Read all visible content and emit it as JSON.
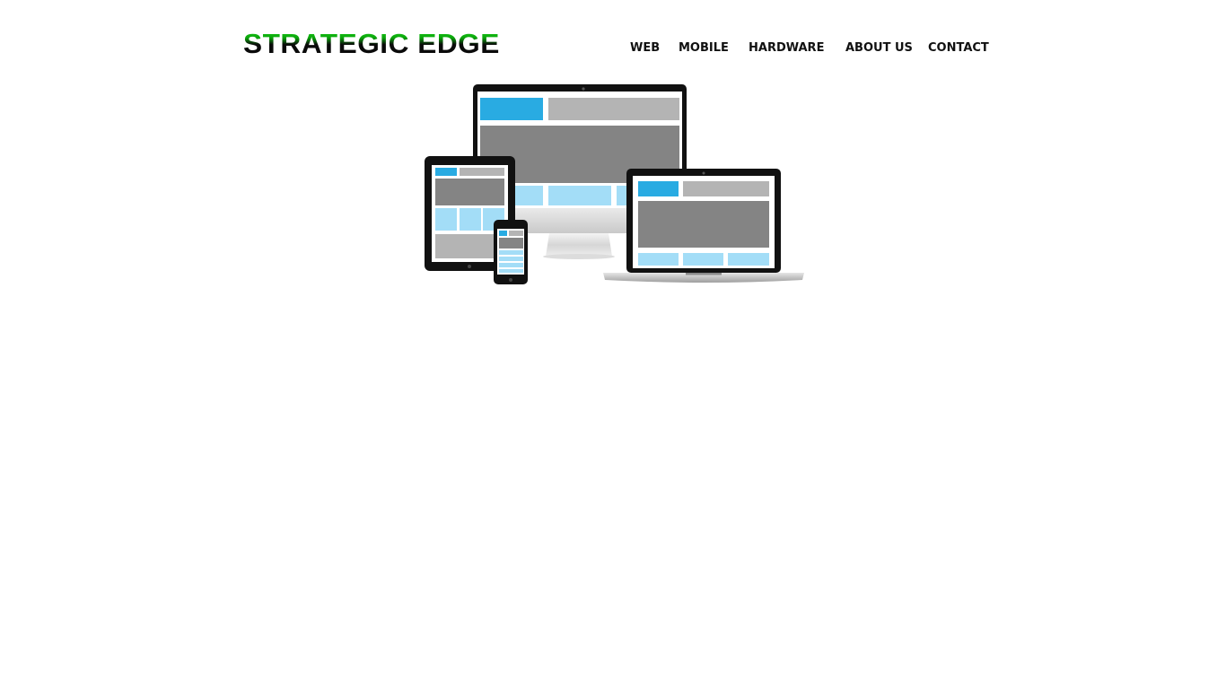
{
  "header": {
    "logo_text": "STRATEGIC EDGE"
  },
  "nav": {
    "items": [
      {
        "label": "WEB"
      },
      {
        "label": "MOBILE"
      },
      {
        "label": "HARDWARE"
      },
      {
        "label": "ABOUT US"
      },
      {
        "label": "CONTACT"
      }
    ]
  },
  "hero": {
    "image": "responsive-devices-illustration",
    "colors": {
      "accent_blue": "#29abe2",
      "light_blue": "#a3ddf7",
      "content_gray": "#848484",
      "light_gray": "#b4b4b4",
      "device_black": "#111111"
    }
  }
}
